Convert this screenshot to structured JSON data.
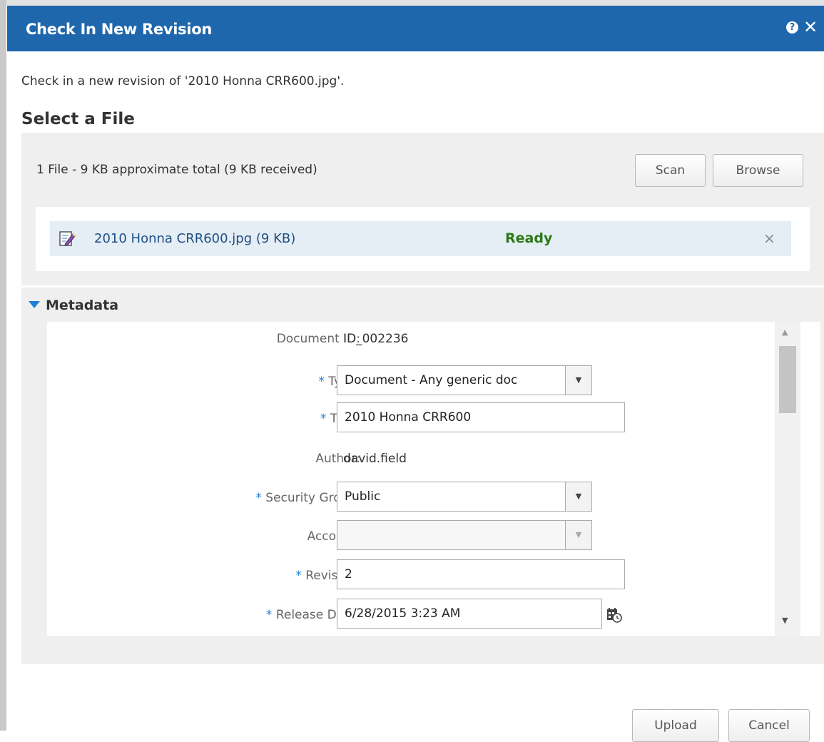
{
  "dialog": {
    "title": "Check In New Revision",
    "help_icon": "?",
    "close_icon": "✕"
  },
  "instruction": "Check in a new revision of '2010 Honna CRR600.jpg'.",
  "select_file": {
    "heading": "Select a File",
    "summary": "1 File - 9 KB approximate total  (9 KB received)",
    "scan_label": "Scan",
    "browse_label": "Browse",
    "files": [
      {
        "name": "2010 Honna CRR600.jpg (9 KB)",
        "status": "Ready",
        "remove": "×"
      }
    ]
  },
  "metadata": {
    "heading": "Metadata",
    "fields": {
      "document_id": {
        "label": "Document ID:",
        "value": "ID_002236"
      },
      "type": {
        "label": "Type:",
        "value": "Document - Any generic doc"
      },
      "title": {
        "label": "Title:",
        "value": "2010 Honna CRR600"
      },
      "author": {
        "label": "Author:",
        "value": "david.field"
      },
      "security_group": {
        "label": "Security Group:",
        "value": "Public"
      },
      "account": {
        "label": "Account:",
        "value": ""
      },
      "revision": {
        "label": "Revision:",
        "value": "2"
      },
      "release_date": {
        "label": "Release Date:",
        "value": "6/28/2015 3:23 AM"
      }
    },
    "required_marker": "*"
  },
  "footer": {
    "upload_label": "Upload",
    "cancel_label": "Cancel"
  },
  "colors": {
    "titlebar": "#1e67ad",
    "ready_status": "#2b7a17",
    "required": "#1e7fd6"
  }
}
